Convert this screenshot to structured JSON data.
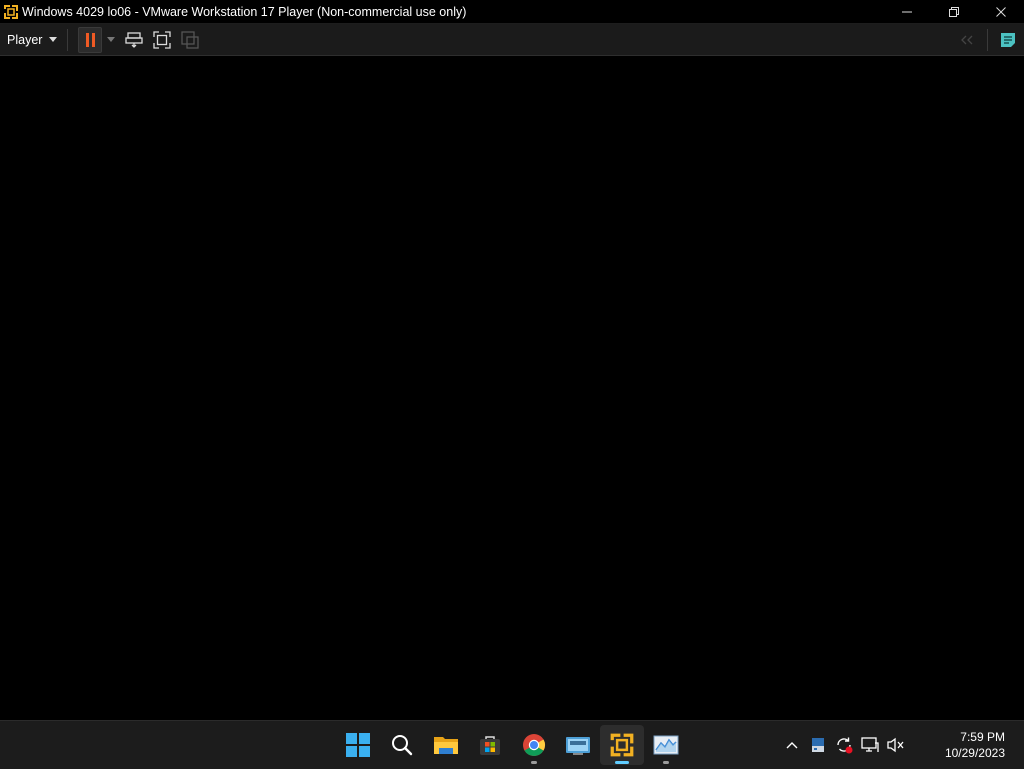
{
  "window": {
    "title": "Windows 4029 lo06 - VMware Workstation 17 Player (Non-commercial use only)",
    "icon": "vmware-icon",
    "controls": [
      "minimize-icon",
      "restore-icon",
      "close-icon"
    ]
  },
  "toolbar": {
    "player_menu_label": "Player",
    "buttons": [
      "pause-icon",
      "dropdown-arrow-icon",
      "send-ctrl-alt-del-icon",
      "full-screen-icon",
      "unity-icon"
    ],
    "right_buttons": [
      "back-icon",
      "library-panel-icon"
    ],
    "pause_color": "#f05a24"
  },
  "taskbar": {
    "apps": [
      "start-icon",
      "search-icon",
      "file-explorer-icon",
      "microsoft-store-icon",
      "chrome-icon",
      "remote-desktop-icon",
      "vmware-player-icon",
      "performance-monitor-icon"
    ],
    "tray": [
      "show-hidden-icons-chevron-icon",
      "drive-icon",
      "sync-icon",
      "network-icon",
      "volume-muted-icon"
    ],
    "clock": {
      "time": "7:59 PM",
      "date": "10/29/2023"
    },
    "accent_color": "#60cdff"
  }
}
